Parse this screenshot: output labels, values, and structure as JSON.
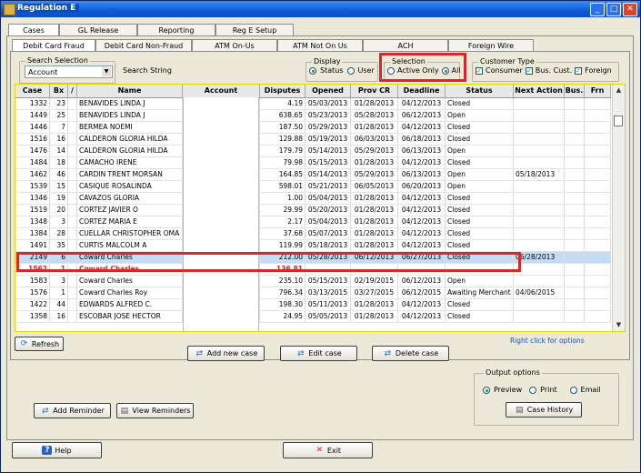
{
  "window": {
    "title": "Regulation E"
  },
  "top_tabs": [
    "Cases",
    "GL Release",
    "Reporting",
    "Reg E Setup"
  ],
  "sub_tabs": [
    "Debit Card Fraud",
    "Debit Card Non-Fraud",
    "ATM On-Us",
    "ATM Not On Us",
    "ACH",
    "Foreign Wire"
  ],
  "search": {
    "group_label": "Search Selection",
    "selected": "Account",
    "string_label": "Search String"
  },
  "display": {
    "label": "Display",
    "options": [
      "Status",
      "User"
    ],
    "selected": "Status"
  },
  "selection": {
    "label": "Selection",
    "options": [
      "Active Only",
      "All"
    ],
    "selected": "All"
  },
  "customer_type": {
    "label": "Customer Type",
    "options": [
      "Consumer",
      "Bus. Cust.",
      "Foreign"
    ]
  },
  "grid": {
    "columns": [
      "Case",
      "Bx",
      "/",
      "Name",
      "Account",
      "Disputes",
      "Opened",
      "Prov CR",
      "Deadline",
      "Status",
      "Next Action",
      "Bus.",
      "Frn"
    ],
    "rows": [
      [
        "1332",
        "23",
        "BENAVIDES LINDA J",
        "4.19",
        "05/03/2013",
        "01/28/2013",
        "04/12/2013",
        "Closed",
        ""
      ],
      [
        "1449",
        "25",
        "BENAVIDES LINDA J",
        "638.65",
        "05/23/2013",
        "05/28/2013",
        "06/12/2013",
        "Open",
        ""
      ],
      [
        "1446",
        "7",
        "BERMEA NOEMI",
        "187.50",
        "05/29/2013",
        "01/28/2013",
        "04/12/2013",
        "Closed",
        ""
      ],
      [
        "1516",
        "16",
        "CALDERON GLORIA HILDA",
        "129.88",
        "05/19/2013",
        "06/03/2013",
        "06/18/2013",
        "Closed",
        ""
      ],
      [
        "1476",
        "14",
        "CALDERON GLORIA HILDA",
        "179.79",
        "05/14/2013",
        "05/29/2013",
        "06/13/2013",
        "Open",
        ""
      ],
      [
        "1484",
        "18",
        "CAMACHO IRENE",
        "79.98",
        "05/15/2013",
        "01/28/2013",
        "04/12/2013",
        "Closed",
        ""
      ],
      [
        "1462",
        "46",
        "CARDIN TRENT MORSAN",
        "164.85",
        "05/14/2013",
        "05/29/2013",
        "06/13/2013",
        "Open",
        "05/18/2013"
      ],
      [
        "1539",
        "15",
        "CASIQUE ROSALINDA",
        "598.01",
        "05/21/2013",
        "06/05/2013",
        "06/20/2013",
        "Open",
        ""
      ],
      [
        "1346",
        "19",
        "CAVAZOS GLORIA",
        "1.00",
        "05/04/2013",
        "01/28/2013",
        "04/12/2013",
        "Closed",
        ""
      ],
      [
        "1519",
        "20",
        "CORTEZ JAVIER O",
        "29.99",
        "05/20/2013",
        "01/28/2013",
        "04/12/2013",
        "Closed",
        ""
      ],
      [
        "1348",
        "3",
        "CORTEZ MARIA E",
        "2.17",
        "05/04/2013",
        "01/28/2013",
        "04/12/2013",
        "Closed",
        ""
      ],
      [
        "1384",
        "28",
        "CUELLAR CHRISTOPHER OMA",
        "37.68",
        "05/07/2013",
        "01/28/2013",
        "04/12/2013",
        "Closed",
        ""
      ],
      [
        "1491",
        "35",
        "CURTIS MALCOLM A",
        "119.99",
        "05/18/2013",
        "01/28/2013",
        "04/12/2013",
        "Closed",
        ""
      ],
      [
        "2149",
        "6",
        "Coward Charles",
        "212.00",
        "05/28/2013",
        "06/12/2013",
        "06/27/2013",
        "Closed",
        "06/28/2013"
      ],
      [
        "1562",
        "1",
        "Coward Charles",
        "136.81",
        "",
        "",
        "",
        "",
        ""
      ],
      [
        "1583",
        "3",
        "Coward Charles",
        "235.10",
        "05/15/2013",
        "02/19/2015",
        "06/12/2013",
        "Open",
        ""
      ],
      [
        "1576",
        "1",
        "Coward Charles Roy",
        "796.34",
        "03/13/2015",
        "03/27/2015",
        "06/12/2015",
        "Awaiting Merchant R",
        "04/06/2015"
      ],
      [
        "1422",
        "44",
        "EDWARDS ALFRED C.",
        "198.30",
        "05/11/2013",
        "01/28/2013",
        "04/12/2013",
        "Closed",
        ""
      ],
      [
        "1358",
        "16",
        "ESCOBAR JOSE HECTOR",
        "24.95",
        "05/05/2013",
        "01/28/2013",
        "04/12/2013",
        "Closed",
        ""
      ]
    ]
  },
  "hint": "Right click for options",
  "buttons": {
    "refresh": "Refresh",
    "add_case": "Add new case",
    "edit_case": "Edit case",
    "delete_case": "Delete case",
    "add_reminder": "Add Reminder",
    "view_reminders": "View Reminders",
    "case_history": "Case History",
    "help": "Help",
    "exit": "Exit"
  },
  "output": {
    "label": "Output options",
    "options": [
      "Preview",
      "Print",
      "Email"
    ],
    "selected": "Preview"
  },
  "colors": {
    "highlight_row": "#c5dcf5",
    "new_row_text": "#d42a2a",
    "callout": "#d42a2a",
    "grid_border": "#e0d800"
  }
}
